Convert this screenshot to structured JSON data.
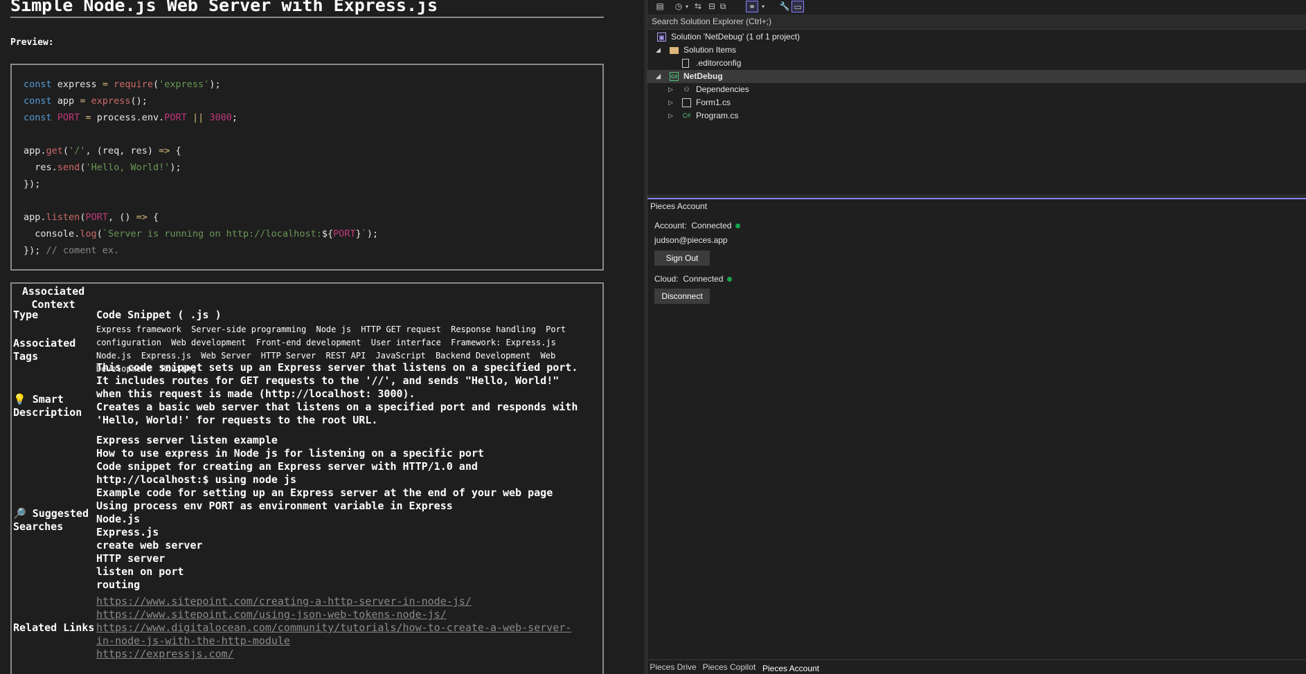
{
  "document": {
    "title": "Simple Node.js Web Server with Express.js",
    "preview_label": "Preview:",
    "code_lines": [
      "",
      "const express = require('express');",
      "const app = express();",
      "const PORT = process.env.PORT || 3000;",
      "",
      "app.get('/', (req, res) => {",
      "  res.send('Hello, World!');",
      "});",
      "",
      "app.listen(PORT, () => {",
      "  console.log(`Server is running on http://localhost:${PORT}`);",
      "}); // coment ex."
    ],
    "context": {
      "heading": "Associated Context",
      "type_label": "Type",
      "type_value": "Code Snippet ( .js )",
      "tags_label": "Associated Tags",
      "tags": [
        "Express framework",
        "Server-side programming",
        "Node js",
        "HTTP GET request",
        "Response handling",
        "Port configuration",
        "Web development",
        "Front-end development",
        "User interface",
        "Framework: Express.js",
        "Node.js",
        "Express.js",
        "Web Server",
        "HTTP Server",
        "REST API",
        "JavaScript",
        "Backend Development",
        "Web Development",
        "Routing"
      ],
      "description_label": "Smart Description",
      "description_icon": "💡",
      "description_lines": [
        "This code snippet sets up an Express server that listens on a specified port.",
        "It includes routes for GET requests to the '//', and sends \"Hello, World!\"",
        "when this request is made (http://localhost: 3000).",
        "Creates a basic web server that listens on a specified port and responds with",
        "'Hello, World!' for requests to the root URL."
      ],
      "searches_label": "Suggested Searches",
      "searches_icon": "🔎",
      "searches": [
        "Express server listen example",
        "How to use express in Node js for listening on a specific port",
        "Code snippet for creating an Express server with HTTP/1.0 and",
        "http://localhost:$ using node js",
        "Example code for setting up an Express server at the end of your web page",
        "Using process env PORT as environment variable in Express",
        "Node.js",
        "Express.js",
        "create web server",
        "HTTP server",
        "listen on port",
        "routing"
      ],
      "links_label": "Related Links",
      "links": [
        "https://www.sitepoint.com/creating-a-http-server-in-node-js/",
        "https://www.sitepoint.com/using-json-web-tokens-node-js/",
        "https://www.digitalocean.com/community/tutorials/how-to-create-a-web-server-",
        "in-node-js-with-the-http-module",
        "https://expressjs.com/"
      ]
    }
  },
  "solution_explorer": {
    "search_placeholder": "Search Solution Explorer (Ctrl+;)",
    "items": [
      {
        "label": "Solution 'NetDebug' (1 of 1 project)",
        "icon": "solution-icon"
      },
      {
        "label": "Solution Items",
        "icon": "folder-icon"
      },
      {
        "label": ".editorconfig",
        "icon": "file-icon"
      },
      {
        "label": "NetDebug",
        "icon": "csharp-project-icon"
      },
      {
        "label": "Dependencies",
        "icon": "dependencies-icon"
      },
      {
        "label": "Form1.cs",
        "icon": "form-icon"
      },
      {
        "label": "Program.cs",
        "icon": "csharp-file-icon"
      }
    ]
  },
  "pieces_account": {
    "header": "Pieces Account",
    "account_label": "Account:",
    "account_status": "Connected",
    "email": "judson@pieces.app",
    "sign_out": "Sign Out",
    "cloud_label": "Cloud:",
    "cloud_status": "Connected",
    "disconnect": "Disconnect",
    "status_color": "#16a34a"
  },
  "bottom_tabs": [
    "Pieces Drive",
    "Pieces Copilot",
    "Pieces Account"
  ]
}
